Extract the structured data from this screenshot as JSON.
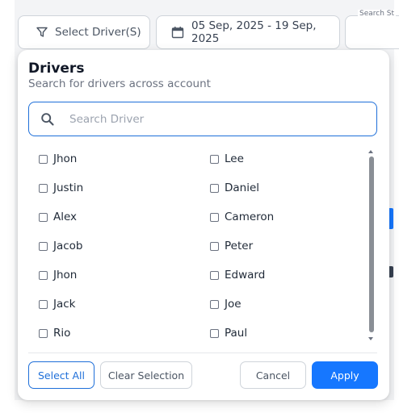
{
  "toolbar": {
    "filter_label": "Select Driver(S)",
    "date_range": "05 Sep, 2025 - 19 Sep, 2025",
    "search_label": "Search St"
  },
  "panel": {
    "title": "Drivers",
    "subtitle": "Search for drivers across account",
    "search_placeholder": "Search Driver",
    "drivers_left": [
      "Jhon",
      "Justin",
      "Alex",
      "Jacob",
      "Jhon",
      "Jack",
      "Rio"
    ],
    "drivers_right": [
      "Lee",
      "Daniel",
      "Cameron",
      "Peter",
      "Edward",
      "Joe",
      "Paul"
    ]
  },
  "actions": {
    "select_all": "Select All",
    "clear_selection": "Clear Selection",
    "cancel": "Cancel",
    "apply": "Apply"
  },
  "colors": {
    "accent": "#1677ff",
    "focus_border": "#1e6fd9"
  },
  "icons": {
    "filter": "filter-icon",
    "calendar": "calendar-icon",
    "search": "search-icon"
  }
}
